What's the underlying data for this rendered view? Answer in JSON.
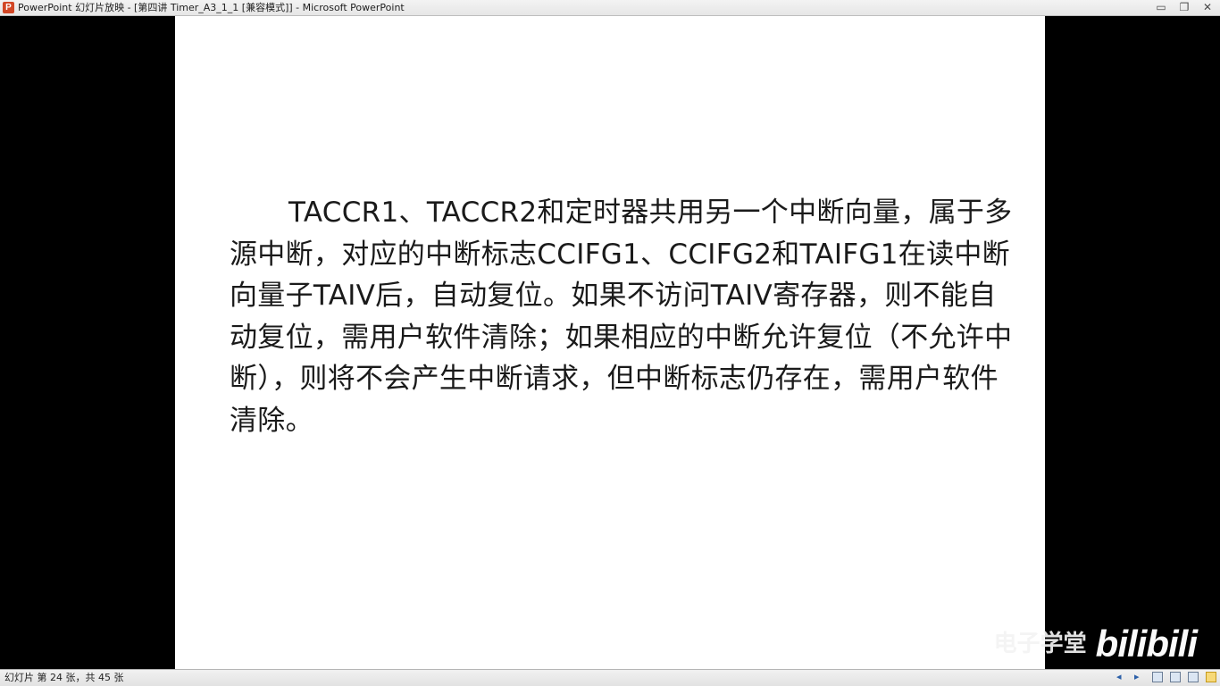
{
  "window": {
    "app_icon_letter": "P",
    "title": "PowerPoint 幻灯片放映 - [第四讲 Timer_A3_1_1 [兼容模式]] - Microsoft PowerPoint",
    "minimize_glyph": "▭",
    "restore_glyph": "❐",
    "close_glyph": "✕"
  },
  "slide": {
    "body": "TACCR1、TACCR2和定时器共用另一个中断向量，属于多源中断，对应的中断标志CCIFG1、CCIFG2和TAIFG1在读中断向量子TAIV后，自动复位。如果不访问TAIV寄存器，则不能自动复位，需用户软件清除；如果相应的中断允许复位（不允许中断），则将不会产生中断请求，但中断标志仍存在，需用户软件清除。"
  },
  "watermark": {
    "chinese": "电子学堂",
    "logo": "bilibili"
  },
  "status": {
    "slide_info": "幻灯片 第 24 张，共 45 张",
    "prev_glyph": "◂",
    "next_glyph": "▸",
    "icons": [
      "normal-view-icon",
      "slide-sorter-icon",
      "reading-view-icon",
      "slideshow-icon"
    ]
  }
}
